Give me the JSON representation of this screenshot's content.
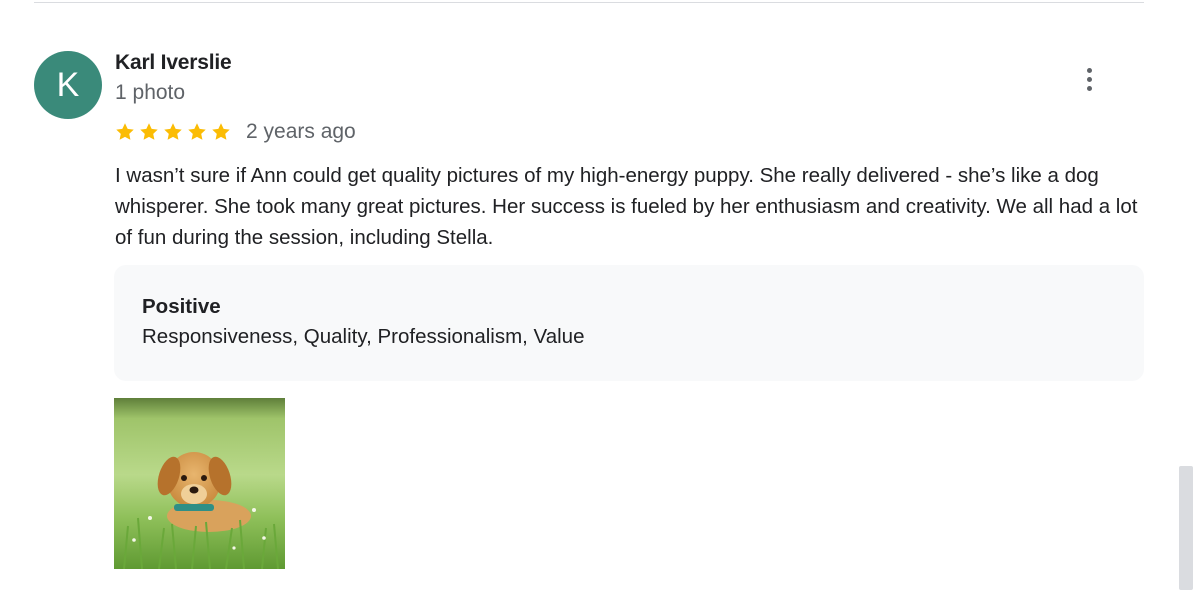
{
  "review": {
    "avatar_initial": "K",
    "avatar_color": "#3a8a7a",
    "reviewer_name": "Karl Iverslie",
    "reviewer_meta": "1 photo",
    "rating": 5,
    "star_color": "#fbbc04",
    "date": "2 years ago",
    "text": "I wasn’t sure if Ann could get quality pictures of my high-energy puppy. She really delivered - she’s like a dog whisperer. She took many great pictures.  Her success is fueled by her enthusiasm and creativity. We all had a lot of fun during the session, including Stella.",
    "highlights": {
      "title": "Positive",
      "values": "Responsiveness, Quality, Professionalism, Value"
    },
    "photo_icon": "puppy-photo"
  },
  "icons": {
    "more": "more-vert-icon",
    "star": "star-icon"
  }
}
